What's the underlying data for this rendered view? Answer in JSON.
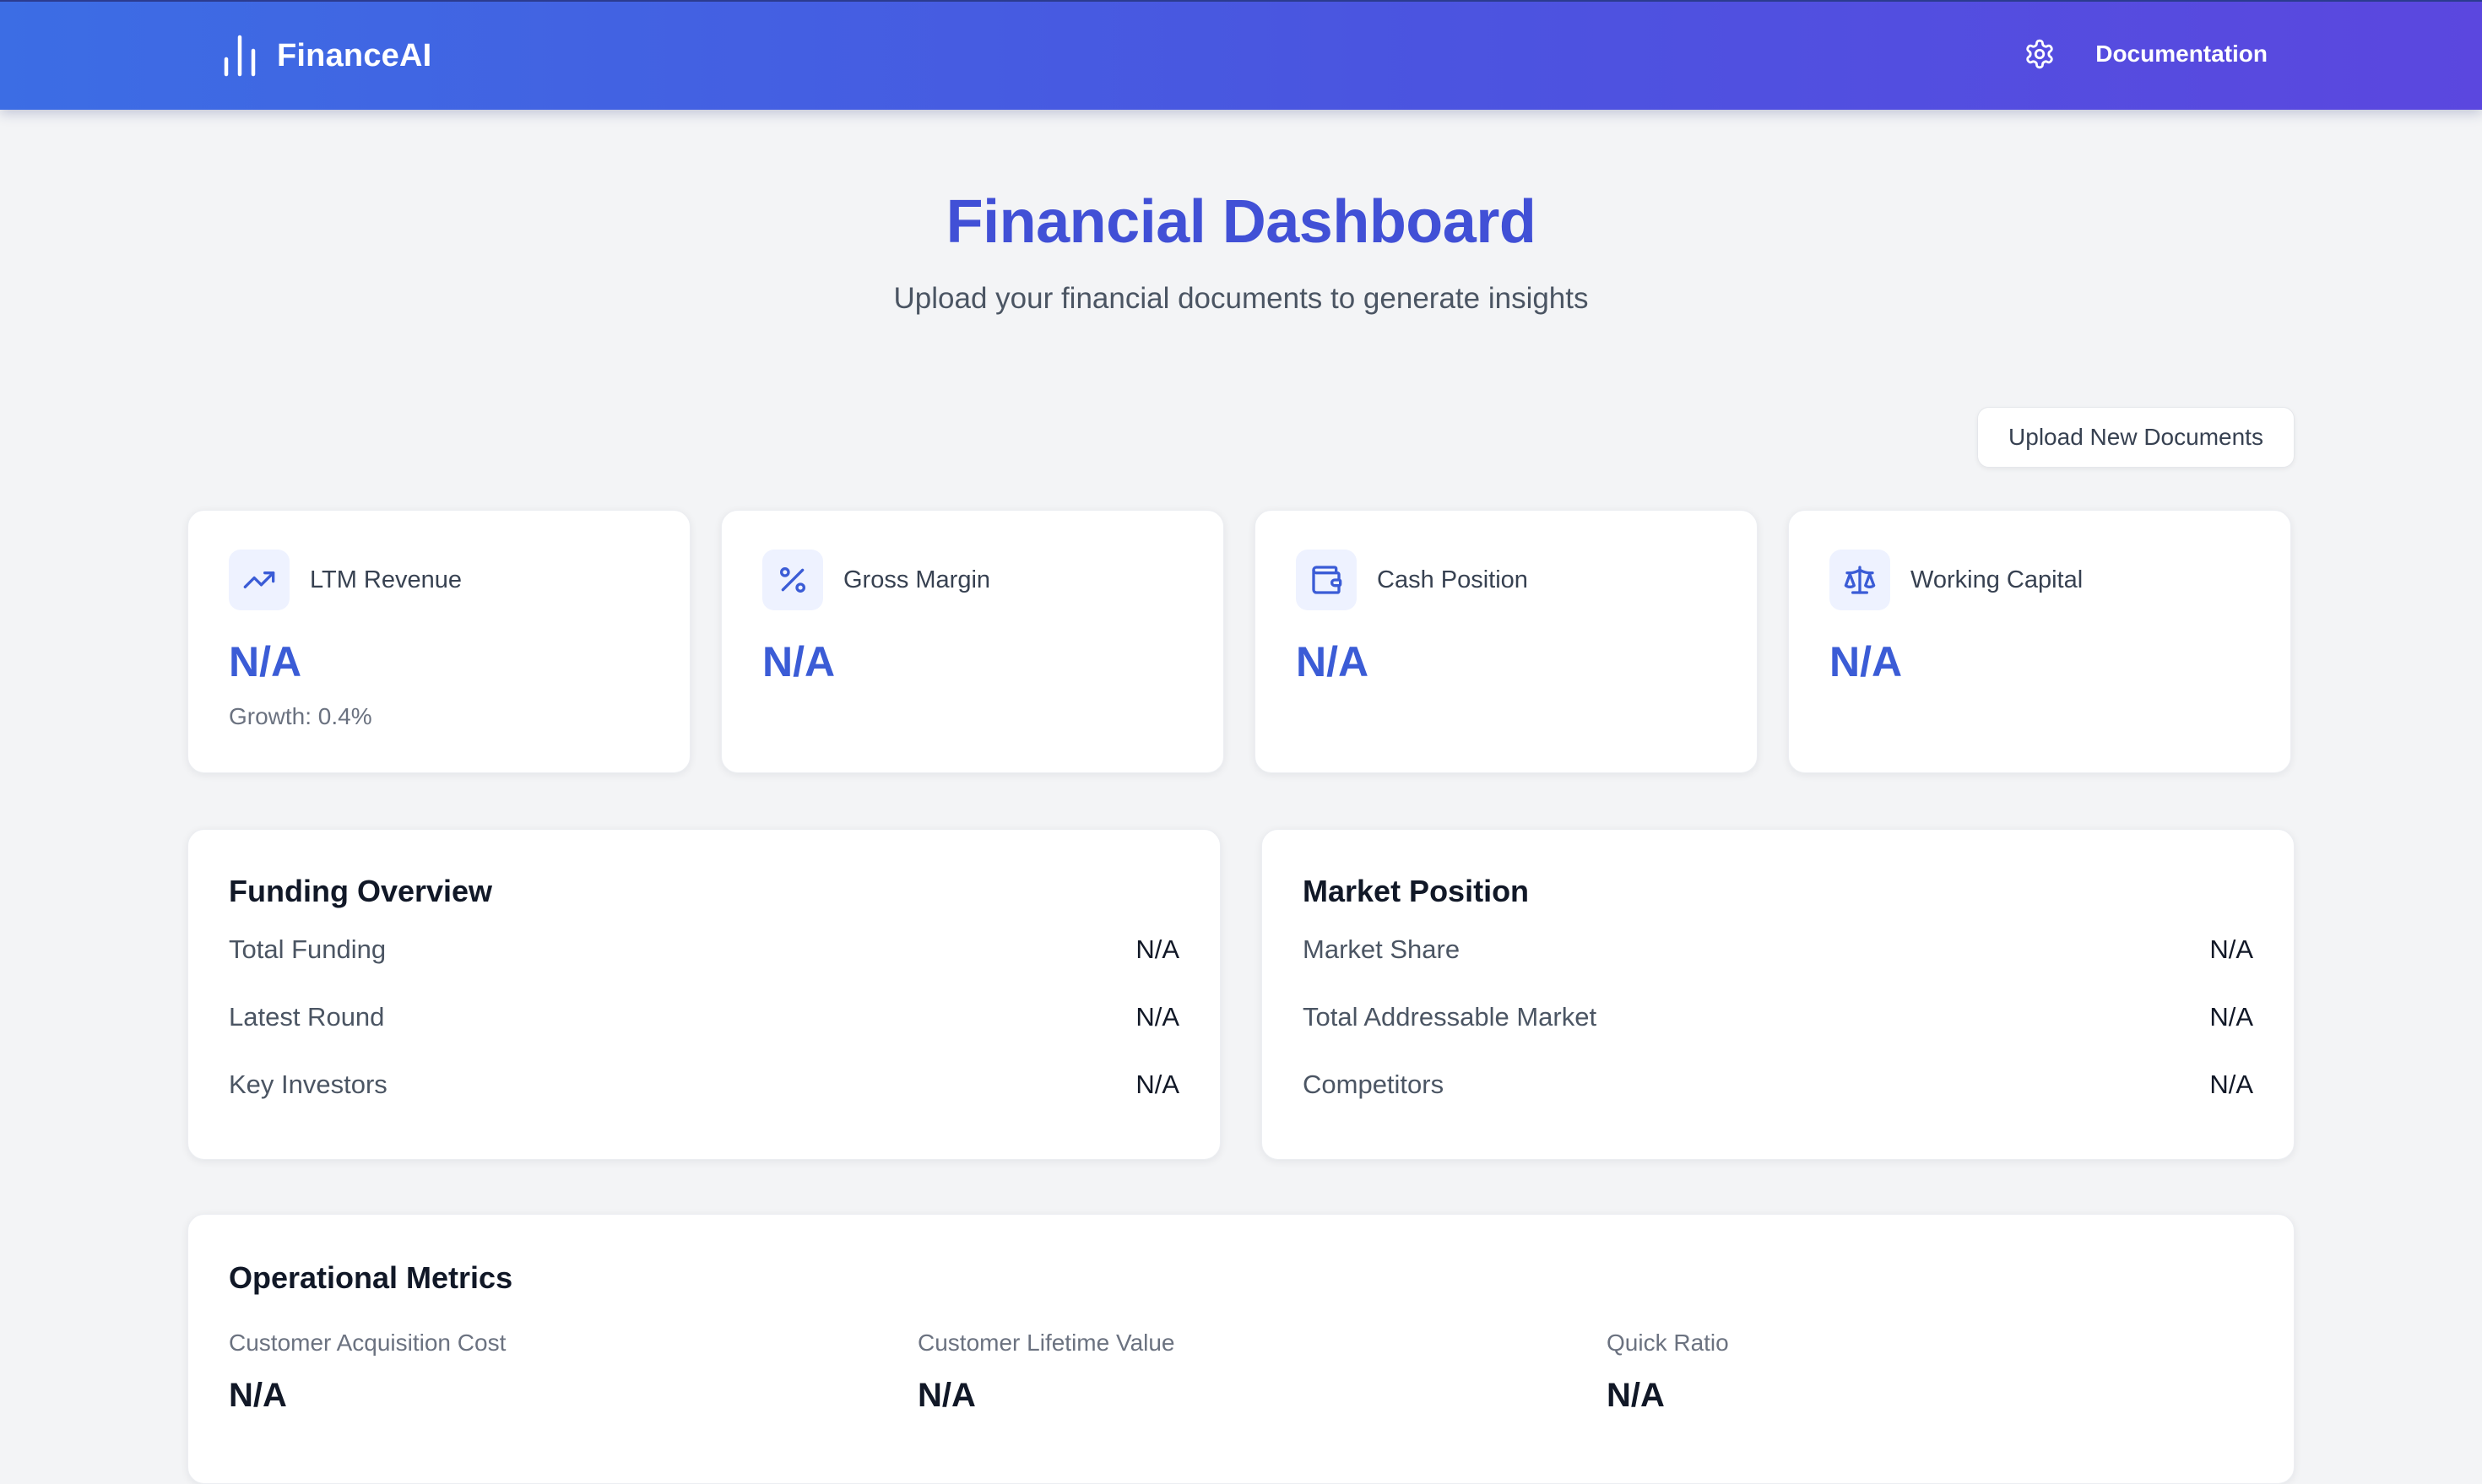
{
  "header": {
    "brand": "FinanceAI",
    "nav_link": "Documentation"
  },
  "hero": {
    "title": "Financial Dashboard",
    "subtitle": "Upload your financial documents to generate insights"
  },
  "actions": {
    "upload_label": "Upload New Documents"
  },
  "metrics": [
    {
      "label": "LTM Revenue",
      "value": "N/A",
      "growth": "Growth: 0.4%",
      "icon": "trending-up-icon"
    },
    {
      "label": "Gross Margin",
      "value": "N/A",
      "icon": "percent-icon"
    },
    {
      "label": "Cash Position",
      "value": "N/A",
      "icon": "wallet-icon"
    },
    {
      "label": "Working Capital",
      "value": "N/A",
      "icon": "scale-icon"
    }
  ],
  "funding": {
    "title": "Funding Overview",
    "rows": [
      {
        "label": "Total Funding",
        "value": "N/A"
      },
      {
        "label": "Latest Round",
        "value": "N/A"
      },
      {
        "label": "Key Investors",
        "value": "N/A"
      }
    ]
  },
  "market": {
    "title": "Market Position",
    "rows": [
      {
        "label": "Market Share",
        "value": "N/A"
      },
      {
        "label": "Total Addressable Market",
        "value": "N/A"
      },
      {
        "label": "Competitors",
        "value": "N/A"
      }
    ]
  },
  "operational": {
    "title": "Operational Metrics",
    "items": [
      {
        "label": "Customer Acquisition Cost",
        "value": "N/A"
      },
      {
        "label": "Customer Lifetime Value",
        "value": "N/A"
      },
      {
        "label": "Quick Ratio",
        "value": "N/A"
      }
    ]
  },
  "colors": {
    "header_gradient_start": "#3c6de4",
    "header_gradient_end": "#5b47df",
    "accent": "#3b5cd6",
    "title": "#4150d6",
    "background": "#f3f4f6"
  }
}
